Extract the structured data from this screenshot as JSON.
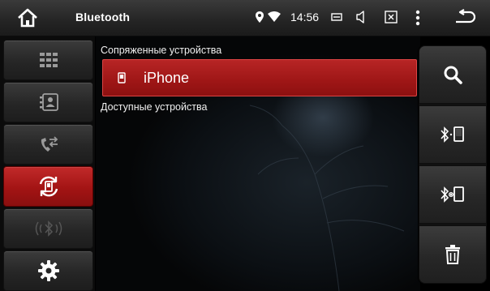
{
  "status_bar": {
    "title": "Bluetooth",
    "time": "14:56",
    "icons": [
      "home-icon",
      "location-icon",
      "wifi-icon",
      "battery-icon",
      "volume-icon",
      "close-box-icon",
      "more-vert-icon",
      "back-icon"
    ]
  },
  "sidebar": {
    "items": [
      {
        "name": "dialpad",
        "icon": "grid-icon",
        "active": false
      },
      {
        "name": "contacts",
        "icon": "contacts-icon",
        "active": false
      },
      {
        "name": "call-log",
        "icon": "call-log-icon",
        "active": false
      },
      {
        "name": "device-pairing",
        "icon": "phone-sync-icon",
        "active": true
      },
      {
        "name": "bluetooth-music",
        "icon": "bluetooth-audio-icon",
        "active": false
      },
      {
        "name": "settings",
        "icon": "gear-icon",
        "active": false
      }
    ]
  },
  "main": {
    "paired_header": "Сопряженные устройства",
    "paired_devices": [
      {
        "name": "iPhone",
        "icon": "phone-icon"
      }
    ],
    "available_header": "Доступные устройства"
  },
  "rightbar": {
    "buttons": [
      {
        "name": "search",
        "icon": "search-icon"
      },
      {
        "name": "connect",
        "icon": "bluetooth-connect-icon"
      },
      {
        "name": "disconnect",
        "icon": "bluetooth-disconnect-icon"
      },
      {
        "name": "delete",
        "icon": "trash-icon"
      }
    ]
  },
  "colors": {
    "accent_red": "#a31414",
    "status_bar": "#2a2a2a",
    "button_gray": "#2e2e2e",
    "background": "#0b0f13"
  }
}
